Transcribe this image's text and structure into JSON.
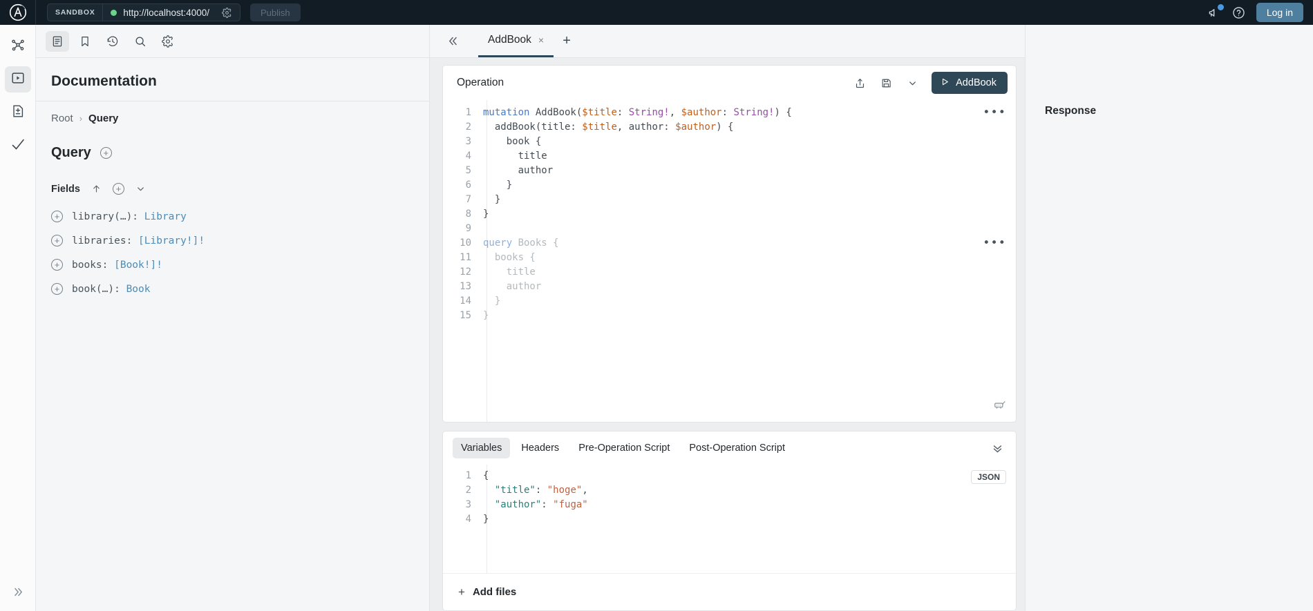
{
  "topbar": {
    "logo_icon": "apollo-logo-icon",
    "sandbox_tag": "SANDBOX",
    "url_value": "http://localhost:4000/",
    "url_gear_icon": "gear-icon",
    "connection_status": "connected",
    "publish_label": "Publish",
    "megaphone_icon": "megaphone-icon",
    "help_icon": "help-circle-icon",
    "login_label": "Log in",
    "accent_color": "#4f7f9e",
    "bar_color": "#121c25",
    "status_dot_color": "#6cd48a"
  },
  "rail": {
    "items": [
      {
        "icon": "schema-graph-icon",
        "active": false
      },
      {
        "icon": "explorer-play-icon",
        "active": true
      },
      {
        "icon": "variant-diff-icon",
        "active": false
      },
      {
        "icon": "checks-checkmark-icon",
        "active": false
      }
    ],
    "expand_icon": "chevron-double-right-icon"
  },
  "documentation": {
    "toolbar": [
      {
        "icon": "docs-page-icon",
        "active": true
      },
      {
        "icon": "bookmark-icon",
        "active": false
      },
      {
        "icon": "history-clock-icon",
        "active": false
      },
      {
        "icon": "search-icon",
        "active": false
      },
      {
        "icon": "gear-icon",
        "active": false
      }
    ],
    "title": "Documentation",
    "breadcrumb": {
      "root": "Root",
      "separator": "›",
      "current": "Query"
    },
    "section": {
      "title": "Query",
      "add_icon": "circle-plus-icon"
    },
    "fields_header": {
      "label": "Fields",
      "sort_icon": "arrow-up-icon",
      "add_icon": "circle-plus-icon",
      "collapse_icon": "chevron-down-icon"
    },
    "fields": [
      {
        "name": "library(…): ",
        "type": "Library"
      },
      {
        "name": "libraries: ",
        "type": "[Library!]!"
      },
      {
        "name": "books: ",
        "type": "[Book!]!"
      },
      {
        "name": "book(…): ",
        "type": "Book"
      }
    ]
  },
  "operation_panel": {
    "collapse_icon": "chevron-double-left-icon",
    "tab": {
      "label": "AddBook",
      "close_icon": "close-icon"
    },
    "add_tab_icon": "plus-icon",
    "header": {
      "title": "Operation",
      "share_icon": "share-upload-icon",
      "save_icon": "save-disk-icon",
      "dropdown_icon": "chevron-down-icon",
      "run_label": "AddBook",
      "run_icon": "play-triangle-icon",
      "run_color": "#2f4858"
    },
    "code_lines": [
      {
        "n": "1",
        "tokens": [
          {
            "t": "mutation ",
            "c": "kw"
          },
          {
            "t": "AddBook(",
            "c": ""
          },
          {
            "t": "$title",
            "c": "var"
          },
          {
            "t": ": ",
            "c": ""
          },
          {
            "t": "String!",
            "c": "typ"
          },
          {
            "t": ", ",
            "c": ""
          },
          {
            "t": "$author",
            "c": "var"
          },
          {
            "t": ": ",
            "c": ""
          },
          {
            "t": "String!",
            "c": "typ"
          },
          {
            "t": ") {",
            "c": ""
          }
        ],
        "indent": 0,
        "menu": true
      },
      {
        "n": "2",
        "tokens": [
          {
            "t": "  addBook(title: ",
            "c": ""
          },
          {
            "t": "$title",
            "c": "var"
          },
          {
            "t": ", author: ",
            "c": ""
          },
          {
            "t": "$author",
            "c": "var"
          },
          {
            "t": ") {",
            "c": ""
          }
        ],
        "indent": 0,
        "menu": false
      },
      {
        "n": "3",
        "tokens": [
          {
            "t": "    book {",
            "c": ""
          }
        ],
        "indent": 0,
        "menu": false
      },
      {
        "n": "4",
        "tokens": [
          {
            "t": "      title",
            "c": ""
          }
        ],
        "indent": 0,
        "menu": false
      },
      {
        "n": "5",
        "tokens": [
          {
            "t": "      author",
            "c": ""
          }
        ],
        "indent": 0,
        "menu": false
      },
      {
        "n": "6",
        "tokens": [
          {
            "t": "    }",
            "c": ""
          }
        ],
        "indent": 0,
        "menu": false
      },
      {
        "n": "7",
        "tokens": [
          {
            "t": "  }",
            "c": ""
          }
        ],
        "indent": 0,
        "menu": false
      },
      {
        "n": "8",
        "tokens": [
          {
            "t": "}",
            "c": ""
          }
        ],
        "indent": 0,
        "menu": false
      },
      {
        "n": "9",
        "tokens": [
          {
            "t": "",
            "c": ""
          }
        ],
        "indent": 0,
        "menu": false
      },
      {
        "n": "10",
        "tokens": [
          {
            "t": "query ",
            "c": "kw-dim"
          },
          {
            "t": "Books {",
            "c": "dim"
          }
        ],
        "indent": 0,
        "menu": true
      },
      {
        "n": "11",
        "tokens": [
          {
            "t": "  books {",
            "c": "dim"
          }
        ],
        "indent": 0,
        "menu": false
      },
      {
        "n": "12",
        "tokens": [
          {
            "t": "    title",
            "c": "dim"
          }
        ],
        "indent": 0,
        "menu": false
      },
      {
        "n": "13",
        "tokens": [
          {
            "t": "    author",
            "c": "dim"
          }
        ],
        "indent": 0,
        "menu": false
      },
      {
        "n": "14",
        "tokens": [
          {
            "t": "  }",
            "c": "dim"
          }
        ],
        "indent": 0,
        "menu": false
      },
      {
        "n": "15",
        "tokens": [
          {
            "t": "}",
            "c": "dim"
          }
        ],
        "indent": 0,
        "menu": false
      }
    ],
    "row_menu_glyph": "•••",
    "format_icon": "format-prettify-icon"
  },
  "variables_panel": {
    "tabs": [
      {
        "label": "Variables",
        "active": true
      },
      {
        "label": "Headers",
        "active": false
      },
      {
        "label": "Pre-Operation Script",
        "active": false
      },
      {
        "label": "Post-Operation Script",
        "active": false
      }
    ],
    "collapse_icon": "chevron-double-down-icon",
    "format_badge": "JSON",
    "json_lines": [
      {
        "n": "1",
        "tokens": [
          {
            "t": "{",
            "c": ""
          }
        ]
      },
      {
        "n": "2",
        "tokens": [
          {
            "t": "  ",
            "c": ""
          },
          {
            "t": "\"title\"",
            "c": "jkey"
          },
          {
            "t": ": ",
            "c": ""
          },
          {
            "t": "\"hoge\"",
            "c": "jstr"
          },
          {
            "t": ",",
            "c": ""
          }
        ]
      },
      {
        "n": "3",
        "tokens": [
          {
            "t": "  ",
            "c": ""
          },
          {
            "t": "\"author\"",
            "c": "jkey"
          },
          {
            "t": ": ",
            "c": ""
          },
          {
            "t": "\"fuga\"",
            "c": "jstr"
          }
        ]
      },
      {
        "n": "4",
        "tokens": [
          {
            "t": "}",
            "c": ""
          }
        ]
      }
    ],
    "add_files": {
      "plus": "+",
      "label": "Add files"
    }
  },
  "response_panel": {
    "title": "Response"
  }
}
